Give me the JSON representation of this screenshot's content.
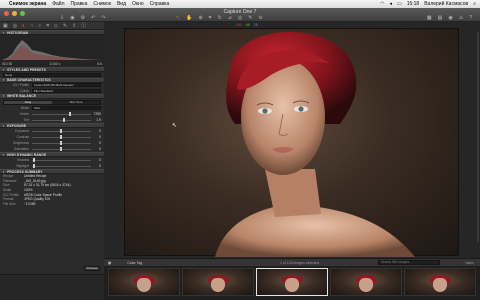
{
  "menubar": {
    "items": [
      "Снимок экрана",
      "Файл",
      "Правка",
      "Снимок",
      "Вид",
      "Окно",
      "Справка"
    ],
    "time": "15:18",
    "user": "Валерий Касмасов"
  },
  "window": {
    "title": "Capture One 7"
  },
  "histogram": {
    "iso": "ISO 50",
    "shutter": "1/160 s",
    "aperture": "5.6"
  },
  "sections": {
    "histogram": "HISTOGRAM",
    "styles": "STYLES AND PRESETS",
    "base": "BASE CHARACTERISTICS",
    "white_balance": "WHITE BALANCE",
    "exposure": "EXPOSURE",
    "hdr": "HIGH DYNAMIC RANGE",
    "summary": "PROCESS SUMMARY"
  },
  "styles": {
    "value": "None"
  },
  "base": {
    "icc_label": "ICC Profile",
    "icc_value": "Canon EOS-5D Mark Generic",
    "curve_label": "Curve",
    "curve_value": "Film Standard"
  },
  "white_balance": {
    "tab_active": "Gray",
    "tab_other": "Skin Tone",
    "mode_label": "Mode",
    "mode_value": "Shot",
    "kelvin_label": "Kelvin",
    "kelvin_value": "7290",
    "tint_label": "Tint",
    "tint_value": "1.9"
  },
  "exposure": {
    "rows": [
      {
        "label": "Exposure",
        "value": "0"
      },
      {
        "label": "Contrast",
        "value": "0"
      },
      {
        "label": "Brightness",
        "value": "0"
      },
      {
        "label": "Saturation",
        "value": "0"
      }
    ]
  },
  "hdr": {
    "rows": [
      {
        "label": "Shadow",
        "value": "0"
      },
      {
        "label": "Highlight",
        "value": "0"
      }
    ]
  },
  "summary": {
    "rows": [
      {
        "label": "Recipe",
        "value": "Untitled Recipe"
      },
      {
        "label": "Filename",
        "value": "_MG_6149.jpg"
      },
      {
        "label": "Size",
        "value": "67,31 x 31,79 cm (5616 x 3744)"
      },
      {
        "label": "Scale",
        "value": "100%"
      },
      {
        "label": "ICC Profile",
        "value": "sRGB Color Space Profile"
      },
      {
        "label": "Format",
        "value": "JPEG Quality 100"
      },
      {
        "label": "File Size",
        "value": "~13 MB"
      }
    ],
    "button": "Process"
  },
  "viewer": {
    "rgb": [
      "242",
      "49",
      "25"
    ]
  },
  "filter": {
    "label": "Color Tag",
    "count": "1 of 133 images selected",
    "search_placeholder": "Search filter images",
    "sort": "Name"
  },
  "colors": {
    "accent": "#e06a1c",
    "hair": "#8b1a22"
  }
}
